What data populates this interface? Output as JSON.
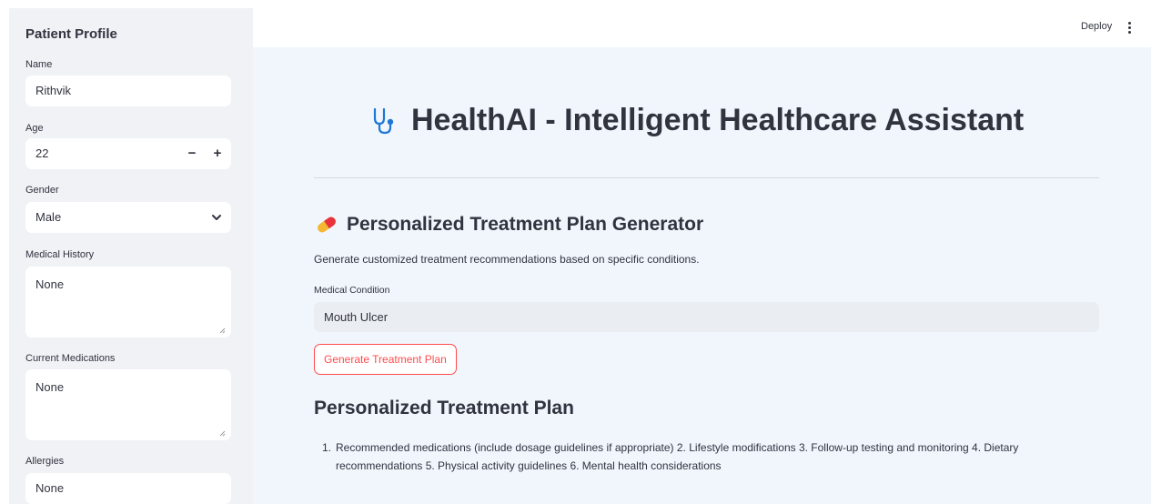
{
  "sidebar": {
    "title": "Patient Profile",
    "name_label": "Name",
    "name_value": "Rithvik",
    "age_label": "Age",
    "age_value": "22",
    "age_minus": "−",
    "age_plus": "+",
    "gender_label": "Gender",
    "gender_value": "Male",
    "history_label": "Medical History",
    "history_value": "None",
    "meds_label": "Current Medications",
    "meds_value": "None",
    "allergies_label": "Allergies",
    "allergies_value": "None"
  },
  "header": {
    "deploy_label": "Deploy",
    "menu_icon": "kebab-menu-icon"
  },
  "main": {
    "title": "HealthAI - Intelligent Healthcare Assistant",
    "title_icon": "stethoscope-icon",
    "section_title": "Personalized Treatment Plan Generator",
    "section_icon": "pill-icon",
    "description": "Generate customized treatment recommendations based on specific conditions.",
    "condition_label": "Medical Condition",
    "condition_value": "Mouth Ulcer",
    "generate_button": "Generate Treatment Plan",
    "plan_title": "Personalized Treatment Plan",
    "plan_items": [
      {
        "number": "1.",
        "text": "Recommended medications (include dosage guidelines if appropriate) 2. Lifestyle modifications 3. Follow-up testing and monitoring 4. Dietary recommendations 5. Physical activity guidelines 6. Mental health considerations"
      }
    ]
  },
  "colors": {
    "accent": "#ff4b4b",
    "sidebar_bg": "#f0f2f6",
    "main_bg": "#f0f6fc",
    "text": "#31333f",
    "icon_blue": "#1f77d4"
  }
}
